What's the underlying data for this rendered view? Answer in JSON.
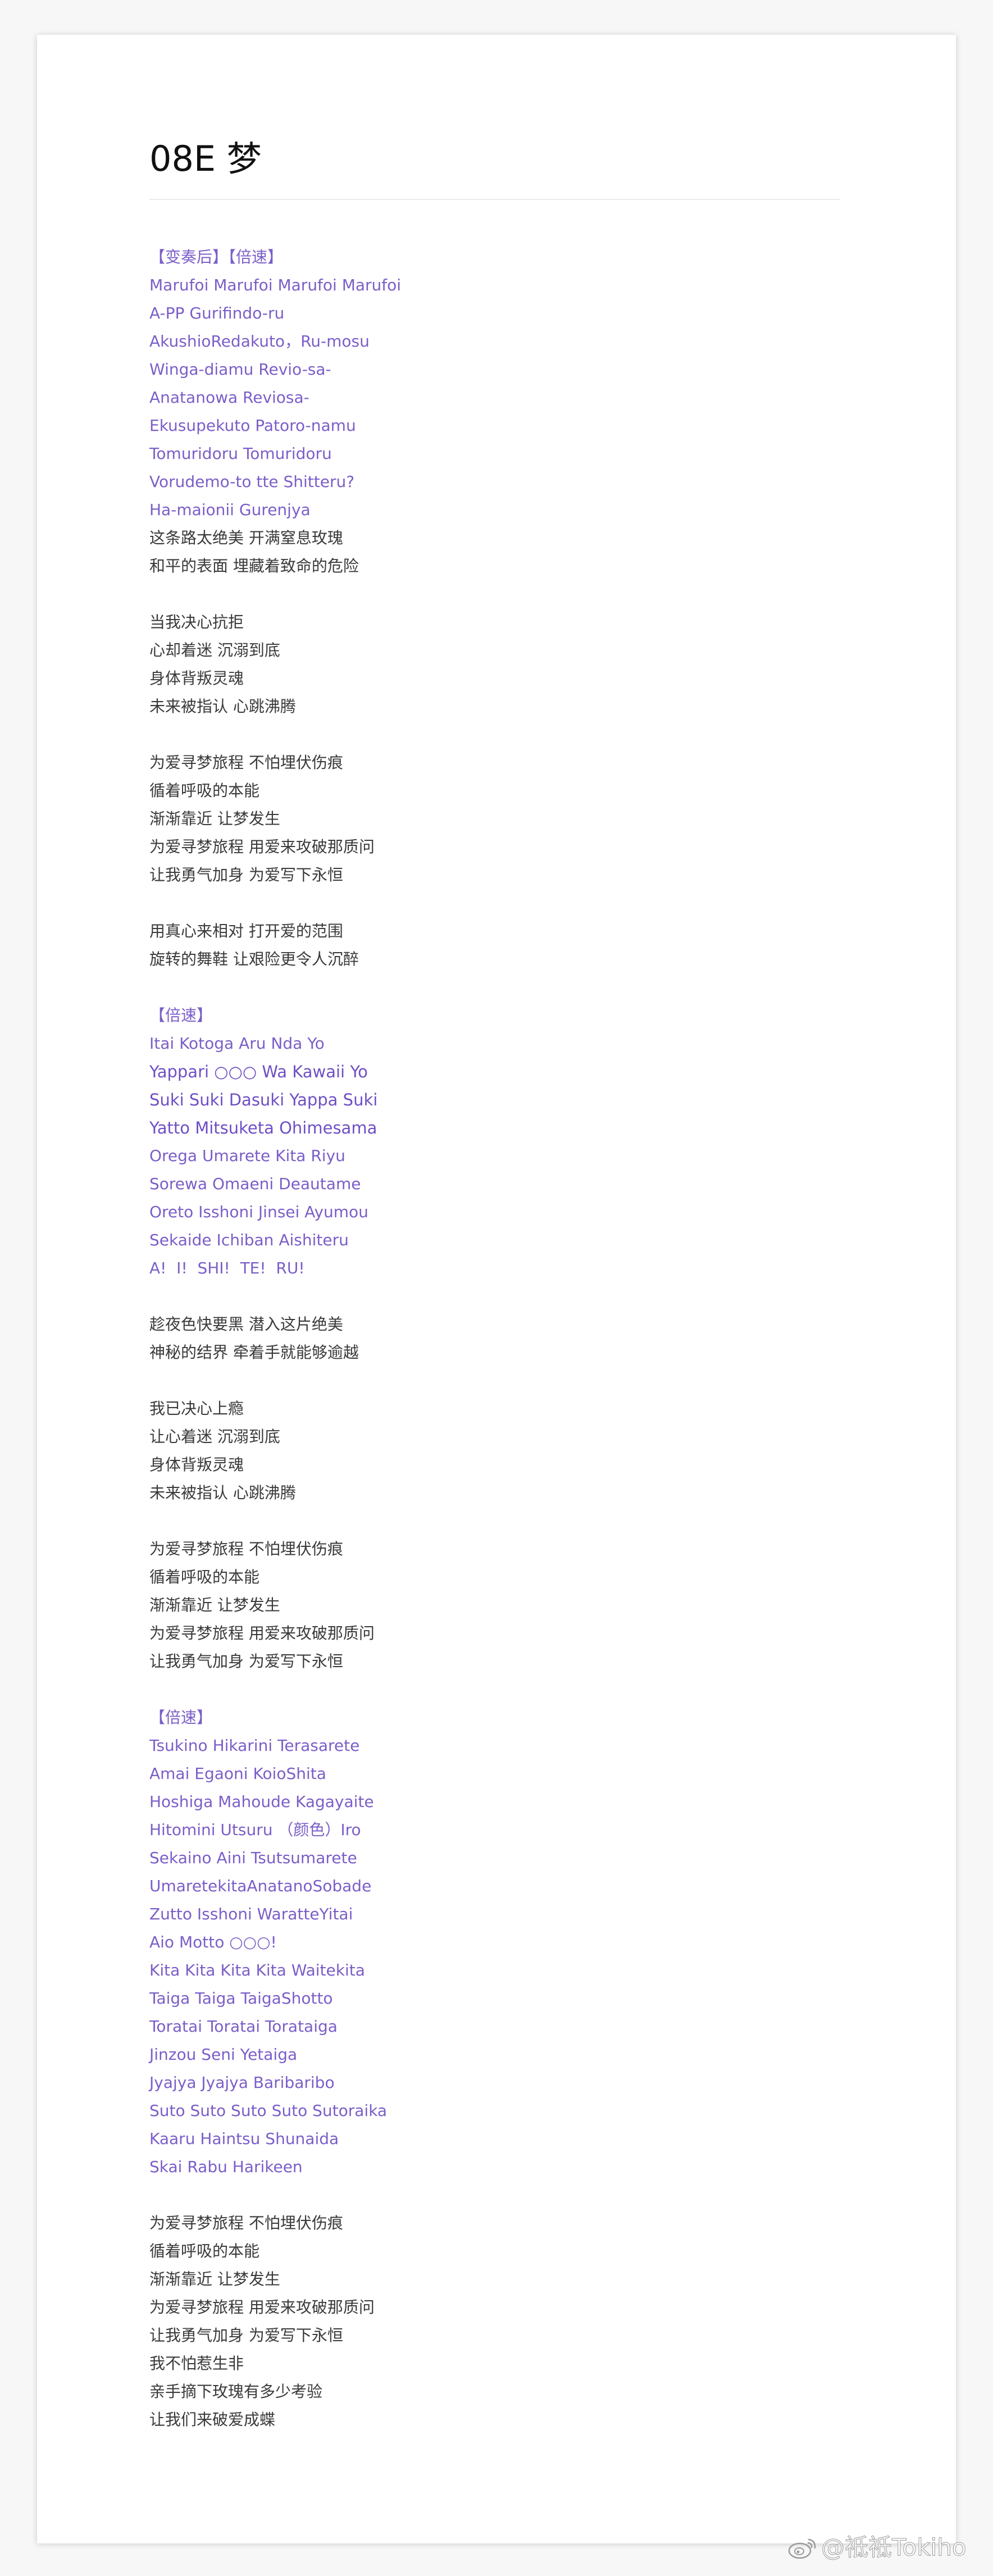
{
  "document": {
    "title": "08E 梦",
    "watermark": "@祗祗Tokiho"
  },
  "lyrics": [
    {
      "t": "【变奏后】【倍速】",
      "c": "p"
    },
    {
      "t": "Marufoi Marufoi Marufoi Marufoi",
      "c": "p"
    },
    {
      "t": "A-PP Gurifindo-ru",
      "c": "p"
    },
    {
      "t": "AkushioRedakuto，Ru-mosu",
      "c": "p"
    },
    {
      "t": "Winga-diamu Revio-sa-",
      "c": "p"
    },
    {
      "t": "Anatanowa Reviosa-",
      "c": "p"
    },
    {
      "t": "Ekusupekuto Patoro-namu",
      "c": "p"
    },
    {
      "t": "Tomuridoru Tomuridoru",
      "c": "p"
    },
    {
      "t": "Vorudemo-to tte Shitteru?",
      "c": "p"
    },
    {
      "t": "Ha-maionii Gurenjya",
      "c": "p"
    },
    {
      "t": "这条路太绝美 开满窒息玫瑰",
      "c": "k"
    },
    {
      "t": "和平的表面 埋藏着致命的危险",
      "c": "k"
    },
    {
      "t": "",
      "c": "blank"
    },
    {
      "t": "当我决心抗拒",
      "c": "k"
    },
    {
      "t": "心却着迷 沉溺到底",
      "c": "k"
    },
    {
      "t": "身体背叛灵魂",
      "c": "k"
    },
    {
      "t": "未来被指认 心跳沸腾",
      "c": "k"
    },
    {
      "t": "",
      "c": "blank"
    },
    {
      "t": "为爱寻梦旅程 不怕埋伏伤痕",
      "c": "k"
    },
    {
      "t": "循着呼吸的本能",
      "c": "k"
    },
    {
      "t": "渐渐靠近 让梦发生",
      "c": "k"
    },
    {
      "t": "为爱寻梦旅程 用爱来攻破那质问",
      "c": "k"
    },
    {
      "t": "让我勇气加身 为爱写下永恒",
      "c": "k"
    },
    {
      "t": "",
      "c": "blank"
    },
    {
      "t": "用真心来相对 打开爱的范围",
      "c": "k"
    },
    {
      "t": "旋转的舞鞋 让艰险更令人沉醉",
      "c": "k"
    },
    {
      "t": "",
      "c": "blank"
    },
    {
      "t": "【倍速】",
      "c": "p"
    },
    {
      "t": "Itai Kotoga Aru Nda Yo",
      "c": "p"
    },
    {
      "t": "Yappari ○○○ Wa Kawaii Yo",
      "c": "pb"
    },
    {
      "t": "Suki Suki Dasuki Yappa Suki",
      "c": "pb"
    },
    {
      "t": "Yatto Mitsuketa Ohimesama",
      "c": "pb"
    },
    {
      "t": "Orega Umarete Kita Riyu",
      "c": "p"
    },
    {
      "t": "Sorewa Omaeni Deautame",
      "c": "p"
    },
    {
      "t": "Oreto Isshoni Jinsei Ayumou",
      "c": "p"
    },
    {
      "t": "Sekaide Ichiban Aishiteru",
      "c": "p"
    },
    {
      "t": "A!  I!  SHI!  TE!  RU!",
      "c": "p"
    },
    {
      "t": "",
      "c": "blank"
    },
    {
      "t": "趁夜色快要黑 潜入这片绝美",
      "c": "k"
    },
    {
      "t": "神秘的结界 牵着手就能够逾越",
      "c": "k"
    },
    {
      "t": "",
      "c": "blank"
    },
    {
      "t": "我已决心上瘾",
      "c": "k"
    },
    {
      "t": "让心着迷 沉溺到底",
      "c": "k"
    },
    {
      "t": "身体背叛灵魂",
      "c": "k"
    },
    {
      "t": "未来被指认 心跳沸腾",
      "c": "k"
    },
    {
      "t": "",
      "c": "blank"
    },
    {
      "t": "为爱寻梦旅程 不怕埋伏伤痕",
      "c": "k"
    },
    {
      "t": "循着呼吸的本能",
      "c": "k"
    },
    {
      "t": "渐渐靠近 让梦发生",
      "c": "k"
    },
    {
      "t": "为爱寻梦旅程 用爱来攻破那质问",
      "c": "k"
    },
    {
      "t": "让我勇气加身 为爱写下永恒",
      "c": "k"
    },
    {
      "t": "",
      "c": "blank"
    },
    {
      "t": "【倍速】",
      "c": "p"
    },
    {
      "t": "Tsukino Hikarini Terasarete",
      "c": "p"
    },
    {
      "t": "Amai Egaoni KoioShita",
      "c": "p"
    },
    {
      "t": "Hoshiga Mahoude Kagayaite",
      "c": "p"
    },
    {
      "t": "Hitomini Utsuru （颜色）Iro",
      "c": "p"
    },
    {
      "t": "Sekaino Aini Tsutsumarete",
      "c": "p"
    },
    {
      "t": "UmaretekitaAnatanoSobade",
      "c": "p"
    },
    {
      "t": "Zutto Isshoni WaratteYitai",
      "c": "p"
    },
    {
      "t": "Aio Motto ○○○!",
      "c": "p"
    },
    {
      "t": "Kita Kita Kita Kita Waitekita",
      "c": "p"
    },
    {
      "t": "Taiga Taiga TaigaShotto",
      "c": "p"
    },
    {
      "t": "Toratai Toratai Torataiga",
      "c": "p"
    },
    {
      "t": "Jinzou Seni Yetaiga",
      "c": "p"
    },
    {
      "t": "Jyajya Jyajya Baribaribo",
      "c": "p"
    },
    {
      "t": "Suto Suto Suto Suto Sutoraika",
      "c": "p"
    },
    {
      "t": "Kaaru Haintsu Shunaida",
      "c": "p"
    },
    {
      "t": "Skai Rabu Harikeen",
      "c": "p"
    },
    {
      "t": "",
      "c": "blank"
    },
    {
      "t": "为爱寻梦旅程 不怕埋伏伤痕",
      "c": "k"
    },
    {
      "t": "循着呼吸的本能",
      "c": "k"
    },
    {
      "t": "渐渐靠近 让梦发生",
      "c": "k"
    },
    {
      "t": "为爱寻梦旅程 用爱来攻破那质问",
      "c": "k"
    },
    {
      "t": "让我勇气加身 为爱写下永恒",
      "c": "k"
    },
    {
      "t": "我不怕惹生非",
      "c": "k"
    },
    {
      "t": "亲手摘下玫瑰有多少考验",
      "c": "k"
    },
    {
      "t": "让我们来破爱成蝶",
      "c": "k"
    }
  ],
  "colors": {
    "lyric_purple": "#7b5ec8",
    "lyric_dark": "#3a3a3a",
    "title": "#111111",
    "background": "#f7f7f7",
    "page": "#ffffff"
  },
  "icons": {
    "watermark_icon": "weibo-logo-icon"
  }
}
